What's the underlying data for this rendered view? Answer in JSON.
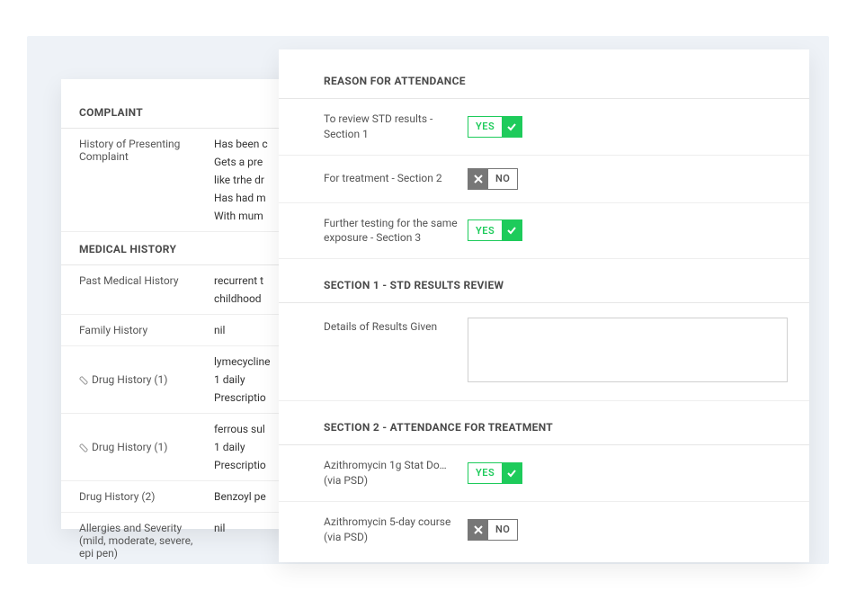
{
  "left": {
    "complaint": {
      "title": "COMPLAINT",
      "history_label": "History of Presenting Complaint",
      "history_lines": [
        "Has been c",
        "Gets a pre",
        "like trhe dr",
        "Has had m",
        "With mum"
      ]
    },
    "medical": {
      "title": "MEDICAL HISTORY",
      "pmh_label": "Past Medical History",
      "pmh_lines": [
        "recurrent t",
        "childhood"
      ],
      "family_label": "Family History",
      "family_value": "nil",
      "drug1_label": "Drug History (1)",
      "drug1_lines": [
        "lymecycline",
        "1 daily",
        "Prescriptio"
      ],
      "drug1b_label": "Drug History (1)",
      "drug1b_lines": [
        "ferrous sul",
        "1 daily",
        "Prescriptio"
      ],
      "drug2_label": "Drug History (2)",
      "drug2_value": "Benzoyl pe",
      "allergy_label": "Allergies and Severity (mild, moderate, severe, epi pen)",
      "allergy_value": "nil"
    }
  },
  "right": {
    "reason": {
      "title": "REASON FOR ATTENDANCE",
      "q1_label": "To review STD results - Section 1",
      "q2_label": "For treatment - Section 2",
      "q3_label": "Further testing for the same exposure - Section 3"
    },
    "section1": {
      "title": "SECTION 1 - STD RESULTS REVIEW",
      "details_label": "Details of Results Given"
    },
    "section2": {
      "title": "SECTION 2 - ATTENDANCE FOR TREATMENT",
      "q1_label": "Azithromycin 1g Stat Do… (via PSD)",
      "q2_label": "Azithromycin 5-day course (via PSD)"
    },
    "labels": {
      "yes": "YES",
      "no": "NO"
    }
  }
}
